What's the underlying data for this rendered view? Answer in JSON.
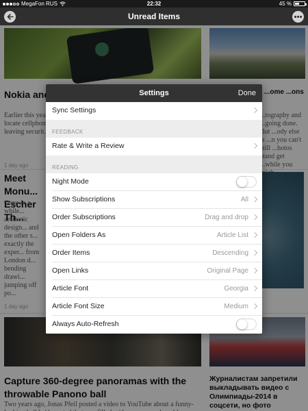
{
  "status_bar": {
    "carrier": "MegaFon RUS",
    "time": "22:32",
    "battery": "45 %"
  },
  "nav": {
    "title": "Unread Items"
  },
  "feed": [
    {
      "title": "Nokia and S... down phon...",
      "excerpt": "Earlier this year... Security Agenc... locate cellphon... didn't provide... leaving securit...",
      "meta": "1 day ago"
    },
    {
      "title": "...ome ...ons",
      "excerpt": "...tography and ...going done. But ...ody else is ...n you can't still ...hotos stand get ...while you migh...",
      "meta": ""
    },
    {
      "title": "Meet Monu... Escher Th...",
      "excerpt": "Once in a while... aesthetic design... and the other s... exactly the exper... from London d... bending drawi... jumping off po...",
      "meta": "1 day ago"
    },
    {
      "title": "",
      "excerpt": "",
      "meta": "1 day ago"
    },
    {
      "title": "Capture 360-degree panoramas with the throwable Panono ball",
      "excerpt": "Two years ago, Jonas Pfeil posted a video to YouTube about a funny-looking ball he'd created that was filled with cameras and could...",
      "meta": ""
    },
    {
      "title": "Журналистам запретили выкладывать видео с Олимпиады-2014 в соцсети, но фото",
      "excerpt": "",
      "meta": ""
    }
  ],
  "settings": {
    "title": "Settings",
    "done_label": "Done",
    "sync_label": "Sync Settings",
    "feedback_header": "FEEDBACK",
    "rate_label": "Rate & Write a Review",
    "reading_header": "READING",
    "night_mode_label": "Night Mode",
    "night_mode_on": false,
    "rows": [
      {
        "label": "Show Subscriptions",
        "value": "All"
      },
      {
        "label": "Order Subscriptions",
        "value": "Drag and drop"
      },
      {
        "label": "Open Folders As",
        "value": "Article List"
      },
      {
        "label": "Order Items",
        "value": "Descending"
      },
      {
        "label": "Open Links",
        "value": "Original Page"
      },
      {
        "label": "Article Font",
        "value": "Georgia"
      },
      {
        "label": "Article Font Size",
        "value": "Medium"
      }
    ],
    "auto_refresh_label": "Always Auto-Refresh",
    "auto_refresh_on": false
  },
  "colors": {
    "nav_bg": "#2f2f2f",
    "modal_header_bg": "#333333",
    "section_bg": "#ededed"
  }
}
